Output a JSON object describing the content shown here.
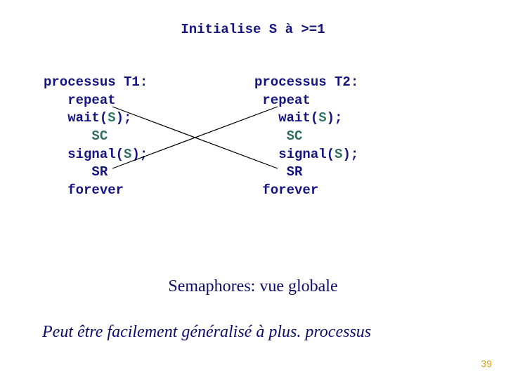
{
  "init": {
    "label": "Initialise S à >=1"
  },
  "processes": {
    "t1": {
      "title": "processus T1:",
      "l1": "repeat",
      "l2_a": "wait(",
      "l2_s": "S",
      "l2_b": ");",
      "l3": "SC",
      "l4_a": "signal(",
      "l4_s": "S",
      "l4_b": ");",
      "l5": "SR",
      "l6": "forever"
    },
    "t2": {
      "title": "processus T2:",
      "l1": "repeat",
      "l2_a": "wait(",
      "l2_s": "S",
      "l2_b": ");",
      "l3": "SC",
      "l4_a": "signal(",
      "l4_s": "S",
      "l4_b": ");",
      "l5": "SR",
      "l6": "forever"
    }
  },
  "caption": "Semaphores: vue globale",
  "note": "Peut être facilement généralisé à plus. processus",
  "page": "39"
}
